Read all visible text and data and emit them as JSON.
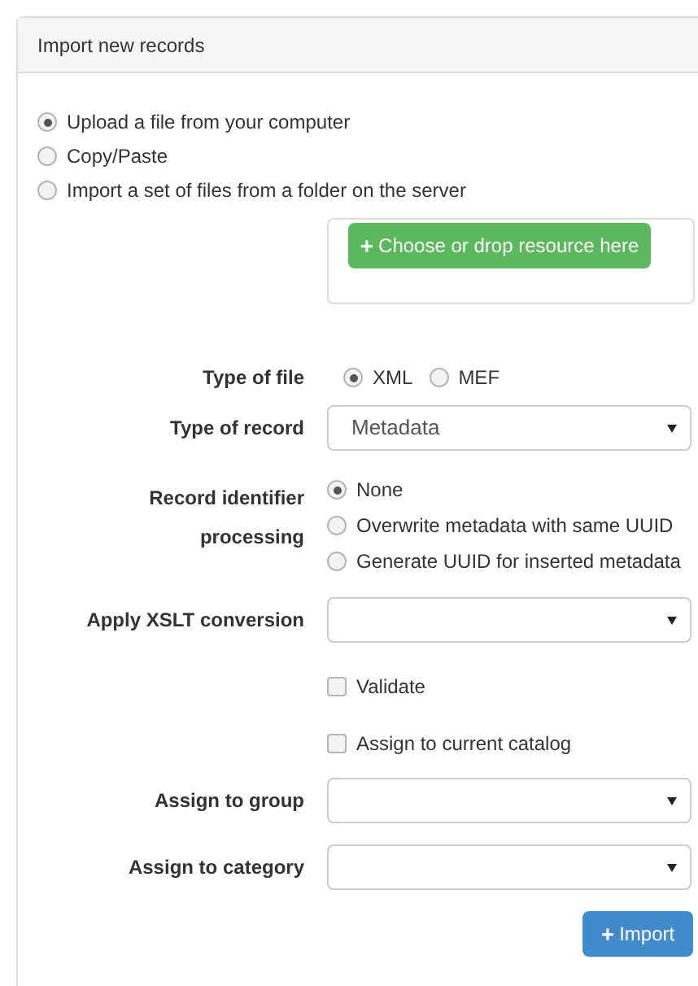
{
  "panel": {
    "title": "Import new records"
  },
  "import_modes": [
    {
      "label": "Upload a file from your computer",
      "selected": true
    },
    {
      "label": "Copy/Paste",
      "selected": false
    },
    {
      "label": "Import a set of files from a folder on the server",
      "selected": false
    }
  ],
  "upload_button": {
    "icon": "+",
    "label": "Choose or drop resource here"
  },
  "file_type": {
    "label": "Type of file",
    "options": [
      {
        "label": "XML",
        "selected": true
      },
      {
        "label": "MEF",
        "selected": false
      }
    ]
  },
  "record_type": {
    "label": "Type of record",
    "value": "Metadata"
  },
  "identifier_processing": {
    "label": "Record identifier processing",
    "options": [
      {
        "label": "None",
        "selected": true
      },
      {
        "label": "Overwrite metadata with same UUID",
        "selected": false
      },
      {
        "label": "Generate UUID for inserted metadata",
        "selected": false
      }
    ]
  },
  "xslt": {
    "label": "Apply XSLT conversion"
  },
  "checkboxes": [
    {
      "label": "Validate",
      "checked": false
    },
    {
      "label": "Assign to current catalog",
      "checked": false
    }
  ],
  "group": {
    "label": "Assign to group"
  },
  "category": {
    "label": "Assign to category"
  },
  "import_button": {
    "icon": "+",
    "label": "Import"
  }
}
